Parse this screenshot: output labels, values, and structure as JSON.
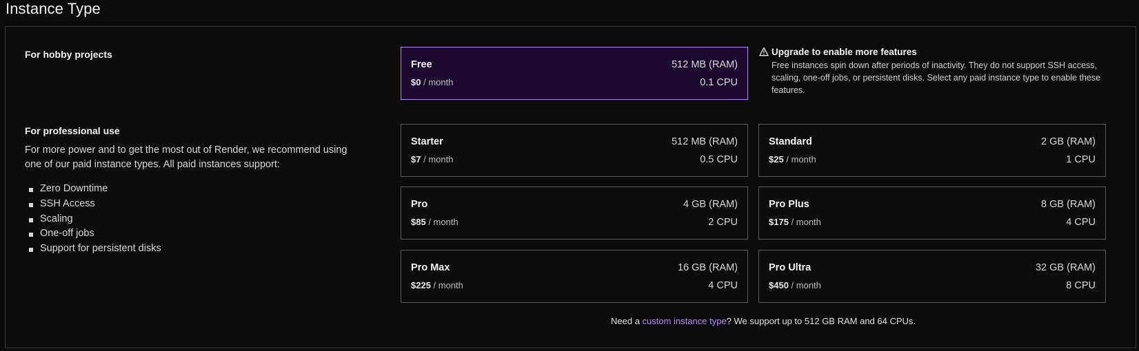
{
  "page": {
    "title": "Instance Type"
  },
  "hobby": {
    "heading": "For hobby projects"
  },
  "professional": {
    "heading": "For professional use",
    "description": "For more power and to get the most out of Render, we recommend using one of our paid instance types. All paid instances support:",
    "features": [
      "Zero Downtime",
      "SSH Access",
      "Scaling",
      "One-off jobs",
      "Support for persistent disks"
    ]
  },
  "instances": {
    "free": {
      "name": "Free",
      "price": "$0",
      "period": "/ month",
      "ram": "512 MB (RAM)",
      "cpu": "0.1 CPU",
      "selected": true
    },
    "starter": {
      "name": "Starter",
      "price": "$7",
      "period": "/ month",
      "ram": "512 MB (RAM)",
      "cpu": "0.5 CPU"
    },
    "standard": {
      "name": "Standard",
      "price": "$25",
      "period": "/ month",
      "ram": "2 GB (RAM)",
      "cpu": "1 CPU"
    },
    "pro": {
      "name": "Pro",
      "price": "$85",
      "period": "/ month",
      "ram": "4 GB (RAM)",
      "cpu": "2 CPU"
    },
    "pro_plus": {
      "name": "Pro Plus",
      "price": "$175",
      "period": "/ month",
      "ram": "8 GB (RAM)",
      "cpu": "4 CPU"
    },
    "pro_max": {
      "name": "Pro Max",
      "price": "$225",
      "period": "/ month",
      "ram": "16 GB (RAM)",
      "cpu": "4 CPU"
    },
    "pro_ultra": {
      "name": "Pro Ultra",
      "price": "$450",
      "period": "/ month",
      "ram": "32 GB (RAM)",
      "cpu": "8 CPU"
    }
  },
  "upgrade_note": {
    "icon": "warning-icon",
    "title": "Upgrade to enable more features",
    "body": "Free instances spin down after periods of inactivity. They do not support SSH access, scaling, one-off jobs, or persistent disks. Select any paid instance type to enable these features."
  },
  "footnote": {
    "prefix": "Need a ",
    "link_text": "custom instance type",
    "suffix": "? We support up to 512 GB RAM and 64 CPUs."
  },
  "colors": {
    "background": "#0c0c0c",
    "selected_card_bg": "#1d0a30",
    "selected_card_border": "#b58cf0",
    "link": "#b48cf5",
    "card_border": "#5a5a5a"
  }
}
